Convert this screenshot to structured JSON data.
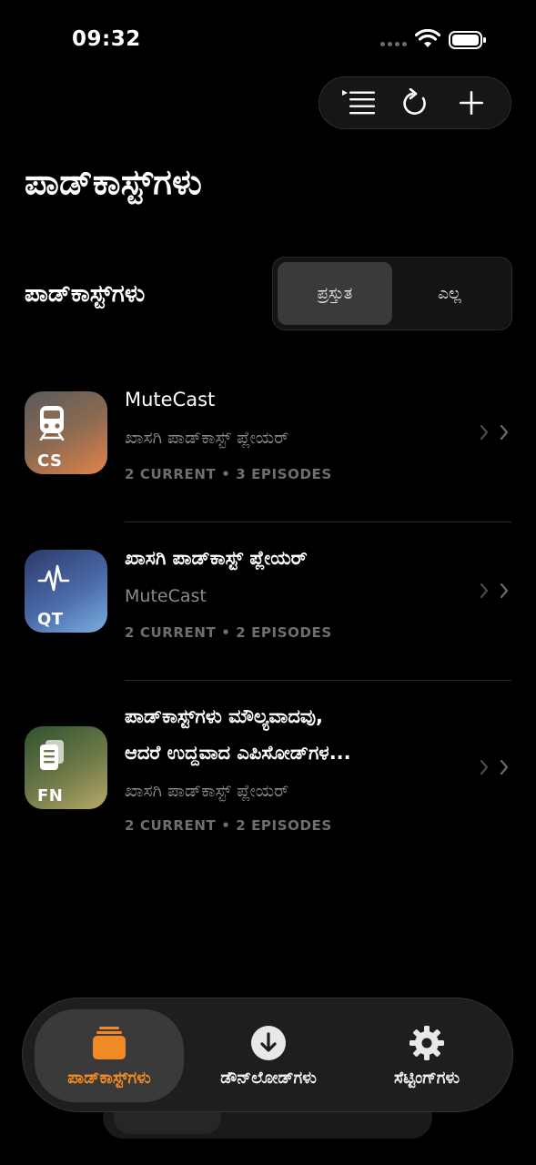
{
  "status": {
    "time": "09:32"
  },
  "toolbar": {
    "icons": [
      "playlist-icon",
      "refresh-icon",
      "plus-icon"
    ]
  },
  "page": {
    "title": "ಪಾಡ್‌ಕಾಸ್ಟ್‌ಗಳು"
  },
  "section": {
    "label": "ಪಾಡ್‌ಕಾಸ್ಟ್‌ಗಳು",
    "segments": [
      {
        "label": "ಪ್ರಸ್ತುತ",
        "selected": true
      },
      {
        "label": "ಎಲ್ಲ",
        "selected": false
      }
    ]
  },
  "podcasts": [
    {
      "title": "MuteCast",
      "subtitle": "ಖಾಸಗಿ ಪಾಡ್‌ಕಾಸ್ಟ್ ಪ್ಲೇಯರ್",
      "meta": "2 CURRENT • 3 EPISODES",
      "artwork_abbr": "CS",
      "artwork_icon": "train-icon"
    },
    {
      "title": "ಖಾಸಗಿ ಪಾಡ್‌ಕಾಸ್ಟ್ ಪ್ಲೇಯರ್",
      "subtitle": "MuteCast",
      "meta": "2 CURRENT • 2 EPISODES",
      "artwork_abbr": "QT",
      "artwork_icon": "waveform-icon"
    },
    {
      "title_line1": "ಪಾಡ್‌ಕಾಸ್ಟ್‌ಗಳು ಮೌಲ್ಯವಾದವು,",
      "title_line2": "ಆದರೆ ಉದ್ದವಾದ ಎಪಿಸೋಡ್‌ಗಳ...",
      "subtitle": "ಖಾಸಗಿ ಪಾಡ್‌ಕಾಸ್ಟ್ ಪ್ಲೇಯರ್",
      "meta": "2 CURRENT • 2 EPISODES",
      "artwork_abbr": "FN",
      "artwork_icon": "document-icon"
    }
  ],
  "tabs": [
    {
      "label": "ಪಾಡ್‌ಕಾಸ್ಟ್‌ಗಳು",
      "icon": "podcasts-stack-icon",
      "active": true
    },
    {
      "label": "ಡೌನ್‌ಲೋಡ್‌ಗಳು",
      "icon": "download-icon",
      "active": false
    },
    {
      "label": "ಸೆಟ್ಟಿಂಗ್‌ಗಳು",
      "icon": "gear-icon",
      "active": false
    }
  ],
  "colors": {
    "accent": "#f08a24",
    "background": "#000000",
    "secondary_text": "#8a8a8a"
  }
}
